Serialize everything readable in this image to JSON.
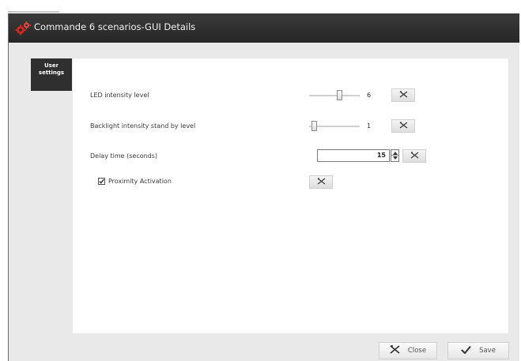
{
  "window": {
    "title": "Commande 6 scenarios-GUI Details"
  },
  "side_tab": {
    "label_line1": "User",
    "label_line2": "settings"
  },
  "settings": {
    "led": {
      "label": "LED intensity level",
      "value": "6",
      "level": 0.6
    },
    "backlight": {
      "label": "Backlight intensity stand by level",
      "value": "1",
      "level": 0.1
    },
    "delay": {
      "label": "Delay time (seconds)",
      "value": "15"
    },
    "proximity": {
      "label": "Proximity Activation",
      "checked": true
    }
  },
  "footer": {
    "close_label": "Close",
    "save_label": "Save"
  },
  "icons": {
    "app": "gears-icon",
    "reset": "reset-x-icon",
    "close": "close-x-icon",
    "save": "checkmark-icon"
  },
  "colors": {
    "titlebar": "#2e2e2e",
    "tab": "#2f2f2f",
    "accent_icon": "#d0281e"
  }
}
